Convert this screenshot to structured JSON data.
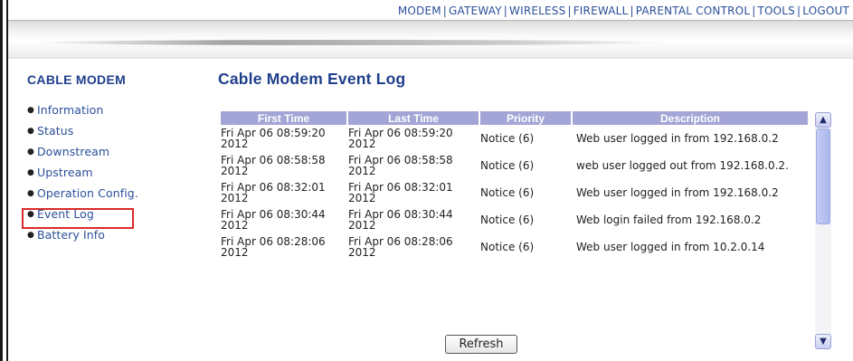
{
  "topnav": {
    "items": [
      "MODEM",
      "GATEWAY",
      "WIRELESS",
      "FIREWALL",
      "PARENTAL CONTROL",
      "TOOLS",
      "LOGOUT"
    ],
    "separator": "|"
  },
  "sidebar": {
    "title": "CABLE MODEM",
    "items": [
      {
        "label": "Information"
      },
      {
        "label": "Status"
      },
      {
        "label": "Downstream"
      },
      {
        "label": "Upstream"
      },
      {
        "label": "Operation Config."
      },
      {
        "label": "Event Log",
        "highlighted": true
      },
      {
        "label": "Battery Info"
      }
    ]
  },
  "main": {
    "title": "Cable Modem Event Log",
    "table": {
      "headers": [
        "First Time",
        "Last Time",
        "Priority",
        "Description"
      ],
      "rows": [
        {
          "first": "Fri Apr 06 08:59:20 2012",
          "last": "Fri Apr 06 08:59:20 2012",
          "priority": "Notice (6)",
          "description": "Web user logged in from 192.168.0.2"
        },
        {
          "first": "Fri Apr 06 08:58:58 2012",
          "last": "Fri Apr 06 08:58:58 2012",
          "priority": "Notice (6)",
          "description": "web user logged out from 192.168.0.2."
        },
        {
          "first": "Fri Apr 06 08:32:01 2012",
          "last": "Fri Apr 06 08:32:01 2012",
          "priority": "Notice (6)",
          "description": "Web user logged in from 192.168.0.2"
        },
        {
          "first": "Fri Apr 06 08:30:44 2012",
          "last": "Fri Apr 06 08:30:44 2012",
          "priority": "Notice (6)",
          "description": "Web login failed from 192.168.0.2"
        },
        {
          "first": "Fri Apr 06 08:28:06 2012",
          "last": "Fri Apr 06 08:28:06 2012",
          "priority": "Notice (6)",
          "description": "Web user logged in from 10.2.0.14"
        }
      ]
    },
    "refresh_label": "Refresh"
  },
  "colors": {
    "accent": "#1f3f8c",
    "link": "#2b4f9a",
    "header_bg": "#a3a5d6",
    "highlight": "#d92b2b"
  },
  "icons": {
    "scroll_up": "chevron-up-icon",
    "scroll_down": "chevron-down-icon",
    "bullet": "bullet-icon"
  }
}
